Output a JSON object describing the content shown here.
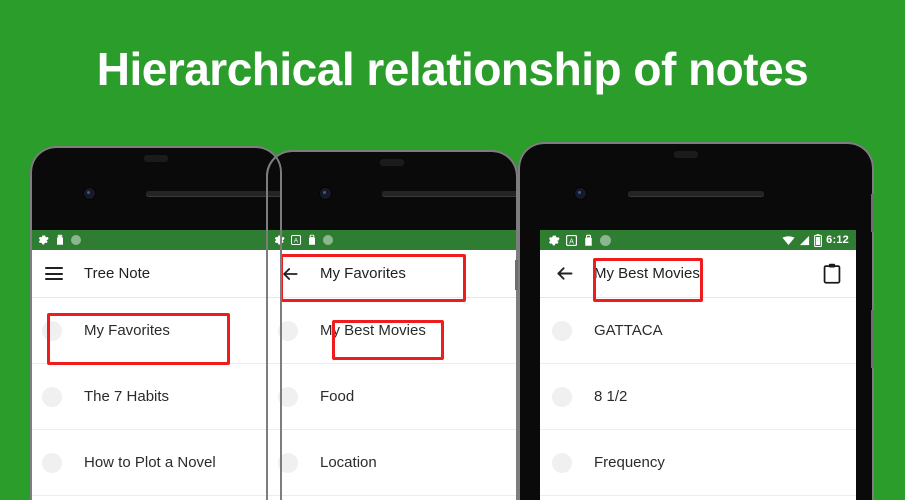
{
  "header": {
    "title": "Hierarchical relationship of notes",
    "background_color": "#2a9d2a",
    "title_color": "#ffffff"
  },
  "theme": {
    "statusbar_color": "#2e7d32",
    "highlight_color": "#ee1c1c",
    "screen_background": "#ffffff",
    "text_color": "#2b2b2b"
  },
  "phones": [
    {
      "id": "phone-1",
      "statusbar": {
        "icons": [
          "gear-icon",
          "bag-icon",
          "circle-icon"
        ],
        "right_icons": [],
        "clock": ""
      },
      "appbar": {
        "nav_icon": "hamburger-icon",
        "title": "Tree Note",
        "action_icon": ""
      },
      "list": [
        {
          "label": "My Favorites",
          "highlighted": true
        },
        {
          "label": "The 7 Habits",
          "highlighted": false
        },
        {
          "label": "How to Plot a Novel",
          "highlighted": false
        }
      ]
    },
    {
      "id": "phone-2",
      "statusbar": {
        "icons": [
          "gear-icon",
          "a-box-icon",
          "bag-icon",
          "circle-icon"
        ],
        "right_icons": [],
        "clock": ""
      },
      "appbar": {
        "nav_icon": "back-arrow-icon",
        "title": "My Favorites",
        "action_icon": "",
        "highlighted": true
      },
      "list": [
        {
          "label": "My Best Movies",
          "highlighted": true
        },
        {
          "label": "Food",
          "highlighted": false
        },
        {
          "label": "Location",
          "highlighted": false
        }
      ]
    },
    {
      "id": "phone-3",
      "statusbar": {
        "icons": [
          "gear-icon",
          "a-box-icon",
          "bag-icon",
          "circle-icon"
        ],
        "right_icons": [
          "wifi-icon",
          "signal-icon",
          "battery-icon"
        ],
        "clock": "6:12"
      },
      "appbar": {
        "nav_icon": "back-arrow-icon",
        "title": "My Best Movies",
        "action_icon": "clipboard-icon",
        "title_highlighted": true
      },
      "list": [
        {
          "label": "GATTACA",
          "highlighted": false
        },
        {
          "label": "8 1/2",
          "highlighted": false
        },
        {
          "label": "Frequency",
          "highlighted": false
        }
      ]
    }
  ]
}
